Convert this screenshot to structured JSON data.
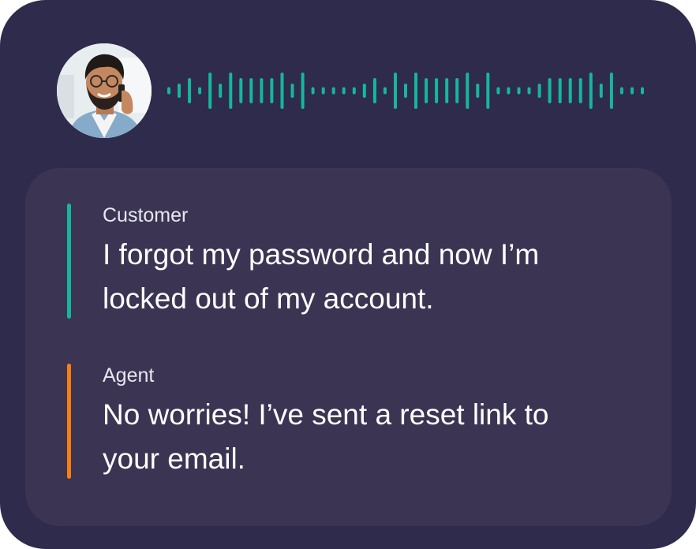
{
  "colors": {
    "card_background": "#2f2b4c",
    "panel_background": "#3b3553",
    "waveform": "#15b79a",
    "customer_accent": "#15b79a",
    "agent_accent": "#f97f10",
    "text": "#ffffff"
  },
  "call": {
    "avatar_icon": "caller-photo",
    "waveform_icon": "audio-waveform-icon"
  },
  "transcript": {
    "customer": {
      "speaker": "Customer",
      "message": "I forgot my password and now I’m locked out of my account."
    },
    "agent": {
      "speaker": "Agent",
      "message": "No worries! I’ve sent a reset link to your email."
    }
  }
}
